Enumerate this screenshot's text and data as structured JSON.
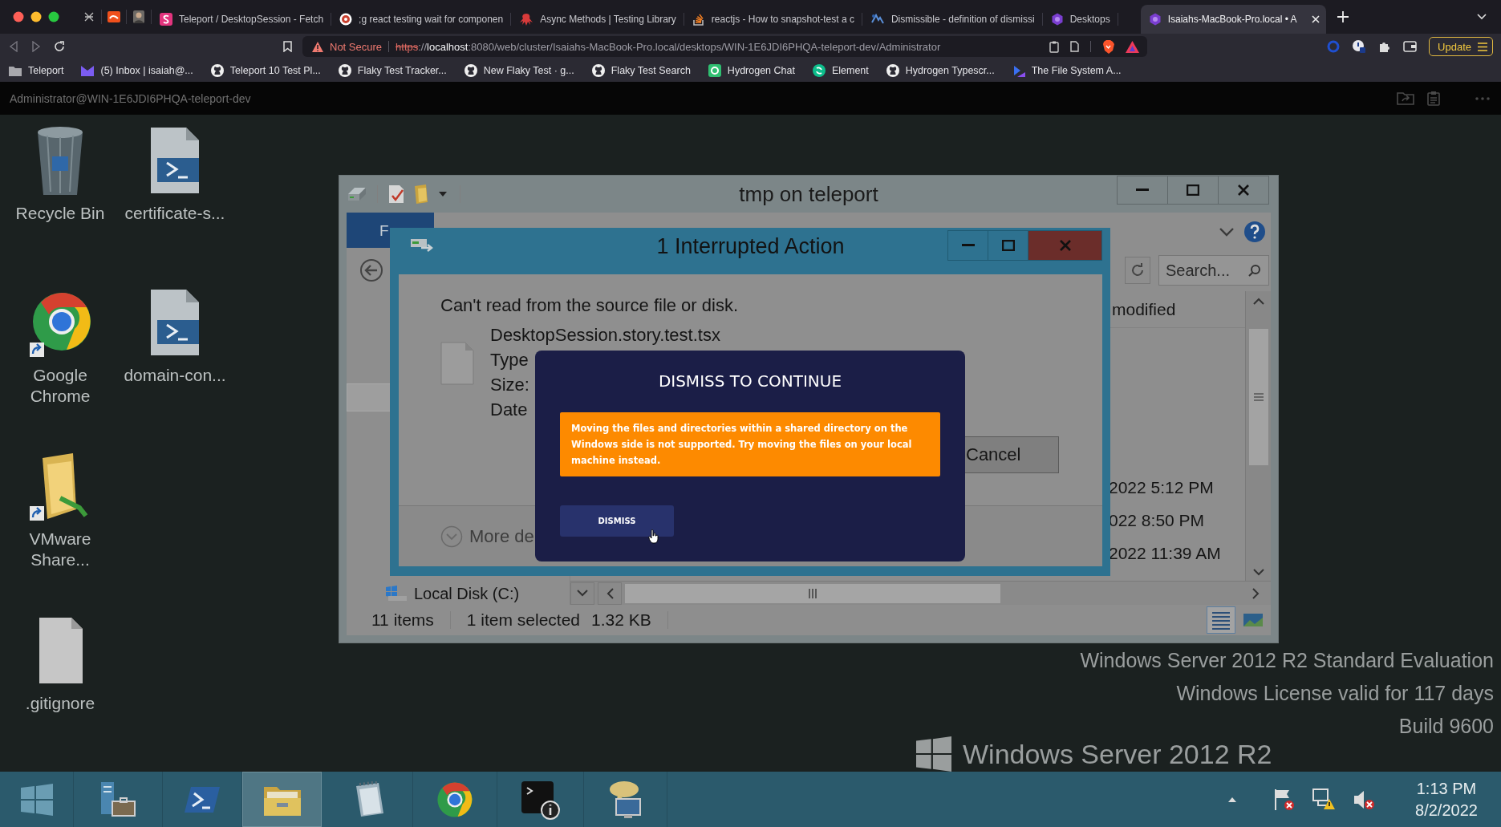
{
  "browser": {
    "tabs": [
      {
        "title": "Teleport / DesktopSession - Fetch",
        "selected": false
      },
      {
        "title": ";g react testing wait for componen",
        "selected": false
      },
      {
        "title": "Async Methods | Testing Library",
        "selected": false
      },
      {
        "title": "reactjs - How to snapshot-test a c",
        "selected": false
      },
      {
        "title": "Dismissible - definition of dismissi",
        "selected": false
      },
      {
        "title": "Desktops",
        "selected": false
      },
      {
        "title": "Isaiahs-MacBook-Pro.local • A",
        "selected": true
      }
    ],
    "address": {
      "security": "Not Secure",
      "scheme": "https",
      "separator": "://",
      "host": "localhost",
      "path": ":8080/web/cluster/Isaiahs-MacBook-Pro.local/desktops/WIN-1E6JDI6PHQA-teleport-dev/Administrator"
    },
    "update_button": "Update",
    "bookmarks": [
      "Teleport",
      "(5) Inbox | isaiah@...",
      "Teleport 10 Test Pl...",
      "Flaky Test Tracker...",
      "New Flaky Test · g...",
      "Flaky Test Search",
      "Hydrogen Chat",
      "Element",
      "Hydrogen Typescr...",
      "The File System A..."
    ]
  },
  "session": {
    "title": "Administrator@WIN-1E6JDI6PHQA-teleport-dev"
  },
  "desktop": {
    "icons": [
      {
        "label": "Recycle Bin",
        "kind": "recycle"
      },
      {
        "label": "certificate-s...",
        "kind": "script"
      },
      {
        "label": "Google Chrome",
        "kind": "chrome"
      },
      {
        "label": "domain-con...",
        "kind": "script"
      },
      {
        "label": "VMware Share...",
        "kind": "folder"
      },
      {
        "label": ".gitignore",
        "kind": "file"
      }
    ],
    "watermark": [
      "Windows Server 2012 R2 Standard Evaluation",
      "Windows License valid for 117 days",
      "Build 9600"
    ],
    "logo_text": "Windows Server 2012 R2"
  },
  "explorer": {
    "title": "tmp on teleport",
    "ribbon_tab": "F",
    "search": {
      "placeholder": "Search..."
    },
    "column_header": "modified",
    "dates": [
      "2022 5:12 PM",
      "022 8:50 PM",
      "2022 11:39 AM"
    ],
    "nav_item": "Local Disk (C:)",
    "status": {
      "count": "11 items",
      "selection": "1 item selected",
      "size": "1.32 KB"
    }
  },
  "dialog": {
    "title": "1 Interrupted Action",
    "message": "Can't read from the source file or disk.",
    "file_name": "DesktopSession.story.test.tsx",
    "file_details": [
      "Type",
      "Size:",
      "Date"
    ],
    "cancel_button": "Cancel",
    "more_details": "More de"
  },
  "modal": {
    "title": "DISMISS TO CONTINUE",
    "warning": "Moving the files and directories within a shared directory on the Windows side is not supported. Try moving the files on your local machine instead.",
    "button": "DISMISS"
  },
  "taskbar": {
    "apps": [
      {
        "kind": "start",
        "selected": false
      },
      {
        "kind": "server-manager",
        "selected": false
      },
      {
        "kind": "powershell",
        "selected": false
      },
      {
        "kind": "explorer",
        "selected": true
      },
      {
        "kind": "notepad",
        "selected": false
      },
      {
        "kind": "chrome",
        "selected": false
      },
      {
        "kind": "terminal",
        "selected": false
      },
      {
        "kind": "network",
        "selected": false
      }
    ],
    "clock": {
      "time": "1:13 PM",
      "date": "8/2/2022"
    }
  }
}
